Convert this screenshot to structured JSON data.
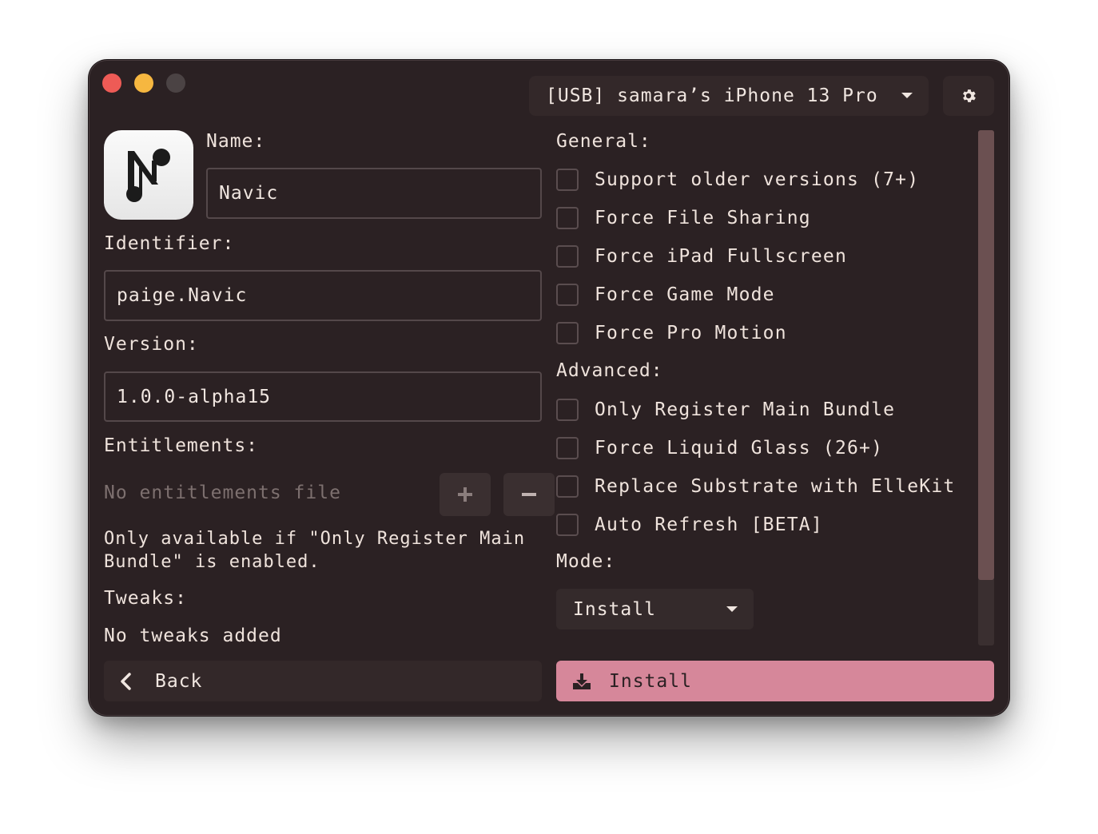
{
  "window": {
    "device_select": "[USB] samara’s iPhone 13 Pro",
    "settings_icon": "gear-icon"
  },
  "app": {
    "icon": "navic-app-icon",
    "name_label": "Name:",
    "name_value": "Navic",
    "identifier_label": "Identifier:",
    "identifier_value": "paige.Navic",
    "version_label": "Version:",
    "version_value": "1.0.0-alpha15",
    "entitlements_label": "Entitlements:",
    "entitlements_value": "No entitlements file",
    "entitlements_note_1": "Only available if \"Only Register Main",
    "entitlements_note_2": "Bundle\" is enabled.",
    "tweaks_label": "Tweaks:",
    "tweaks_value": "No tweaks added"
  },
  "options": {
    "general_label": "General:",
    "general": [
      "Support older versions (7+)",
      "Force File Sharing",
      "Force iPad Fullscreen",
      "Force Game Mode",
      "Force Pro Motion"
    ],
    "advanced_label": "Advanced:",
    "advanced": [
      "Only Register Main Bundle",
      "Force Liquid Glass (26+)",
      "Replace Substrate with ElleKit",
      "Auto Refresh [BETA]"
    ],
    "mode_label": "Mode:",
    "mode_value": "Install"
  },
  "footer": {
    "back_label": "Back",
    "install_label": "Install"
  },
  "colors": {
    "background": "#2b2123",
    "accent": "#d6879a",
    "close": "#ee5b56",
    "minimize": "#f6b740"
  }
}
